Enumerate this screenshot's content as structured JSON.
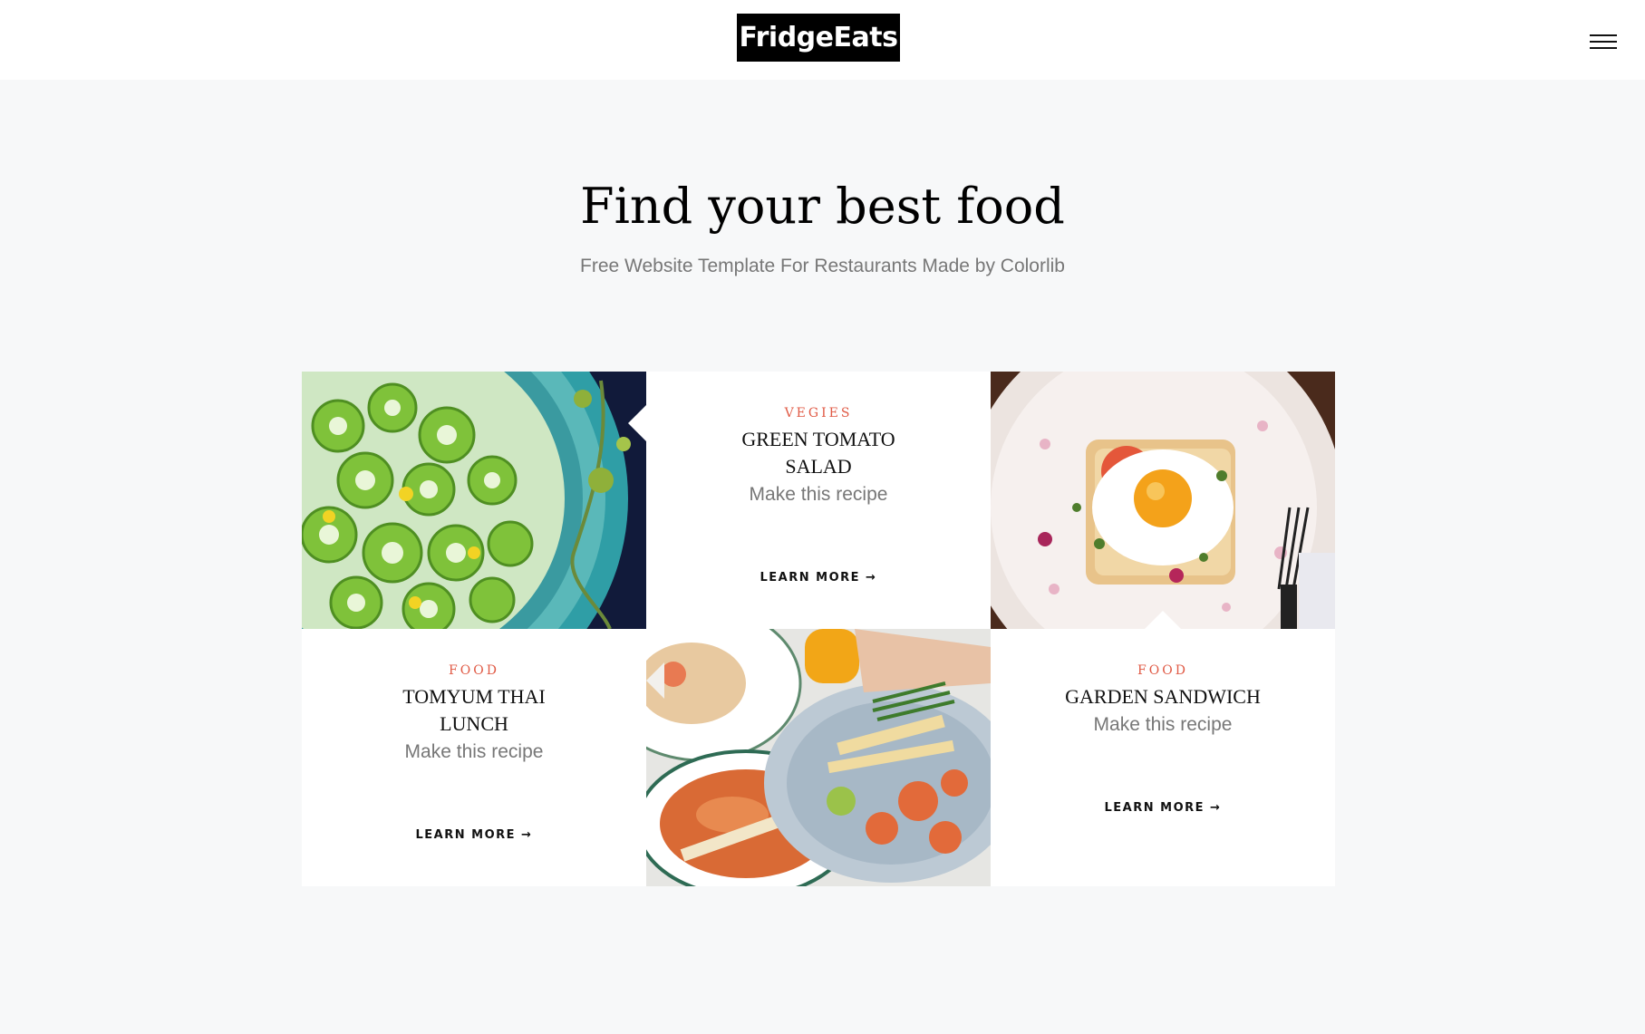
{
  "header": {
    "logo": "FridgeEats",
    "menu_icon": "hamburger-menu-icon"
  },
  "hero": {
    "title": "Find your best food",
    "subtitle": "Free Website Template For Restaurants Made by Colorlib"
  },
  "recipes": [
    {
      "category": "VEGIES",
      "title": "GREEN TOMATO SALAD",
      "description": "Make this recipe",
      "link": "LEARN MORE →",
      "image": "green-tomato-salad-photo"
    },
    {
      "category": "FOOD",
      "title": "TOMYUM THAI LUNCH",
      "description": "Make this recipe",
      "link": "LEARN MORE →",
      "image": "thai-lunch-photo"
    },
    {
      "category": "FOOD",
      "title": "GARDEN SANDWICH",
      "description": "Make this recipe",
      "link": "LEARN MORE →",
      "image": "egg-sandwich-photo"
    }
  ],
  "colors": {
    "accent": "#e05a45",
    "page_background": "#f7f8f9",
    "logo_background": "#000000"
  }
}
